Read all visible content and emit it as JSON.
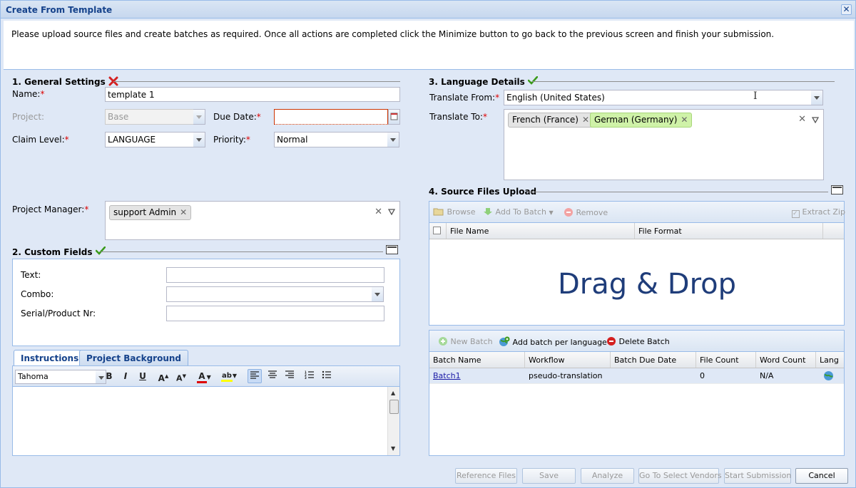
{
  "window": {
    "title": "Create From Template",
    "close_glyph": "✕"
  },
  "intro": "Please upload source files and create batches as required. Once all actions are completed click the Minimize button to go back to the previous screen and finish your submission.",
  "general": {
    "title": "1. General Settings",
    "name_label": "Name:",
    "name_value": "template 1",
    "project_label": "Project:",
    "project_value": "Base",
    "due_date_label": "Due Date:",
    "due_date_value": "",
    "claim_label": "Claim Level:",
    "claim_value": "LANGUAGE",
    "priority_label": "Priority:",
    "priority_value": "Normal",
    "pm_label": "Project Manager:",
    "pm_tags": [
      "support Admin"
    ]
  },
  "custom": {
    "title": "2. Custom Fields",
    "text_label": "Text:",
    "combo_label": "Combo:",
    "serial_label": "Serial/Product Nr:"
  },
  "editor": {
    "tabs": [
      "Instructions",
      "Project Background"
    ],
    "font": "Tahoma"
  },
  "language": {
    "title": "3. Language Details",
    "from_label": "Translate From:",
    "from_value": "English (United States)",
    "to_label": "Translate To:",
    "to_tags": [
      "French (France)",
      "German (Germany)"
    ]
  },
  "upload": {
    "title": "4. Source Files Upload",
    "browse": "Browse",
    "add_to_batch": "Add To Batch",
    "remove": "Remove",
    "extract_zip": "Extract Zip",
    "col_file_name": "File Name",
    "col_file_format": "File Format",
    "drag_drop": "Drag & Drop"
  },
  "batches": {
    "new_batch": "New Batch",
    "add_per_lang": "Add batch per language",
    "delete_batch": "Delete Batch",
    "columns": [
      "Batch Name",
      "Workflow",
      "Batch Due Date",
      "File Count",
      "Word Count",
      "Lang"
    ],
    "rows": [
      {
        "name": "Batch1",
        "workflow": "pseudo-translation",
        "due": "",
        "file_count": "0",
        "word_count": "N/A"
      }
    ]
  },
  "footer": {
    "reference_files": "Reference Files",
    "save": "Save",
    "analyze": "Analyze",
    "go_to_vendors": "Go To Select Vendors",
    "start_submission": "Start Submission",
    "cancel": "Cancel"
  }
}
